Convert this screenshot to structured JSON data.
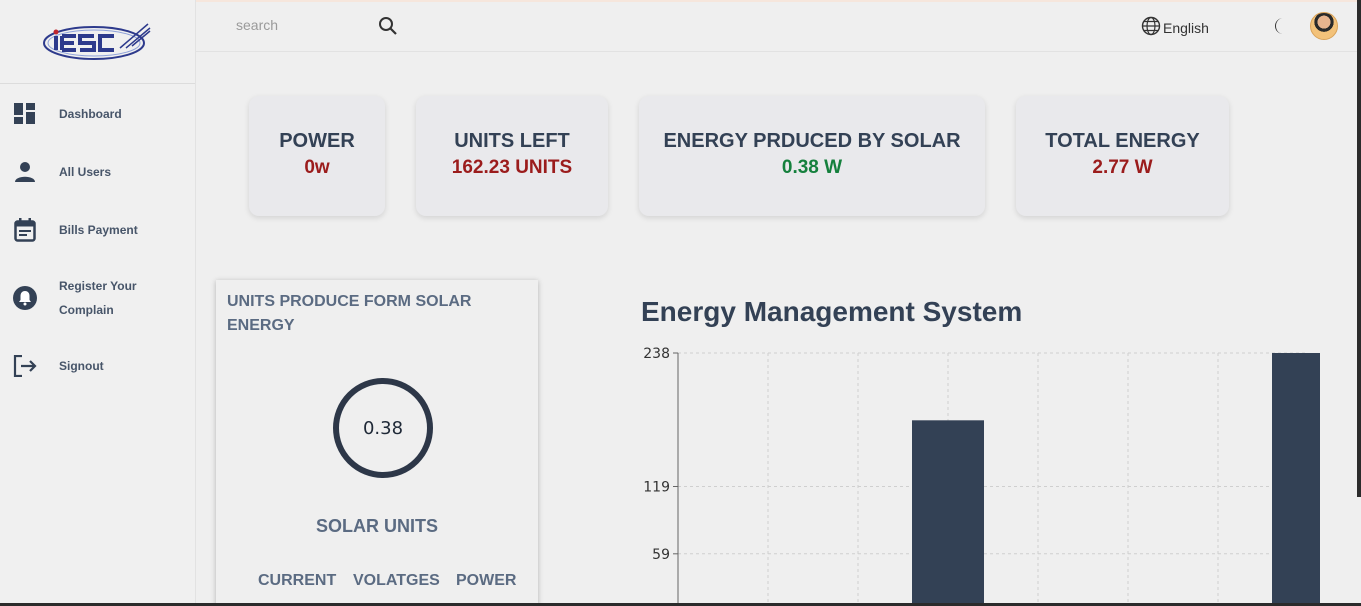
{
  "brand": {
    "logo_text": "IESC"
  },
  "sidebar": {
    "items": [
      {
        "label": "Dashboard",
        "icon": "dashboard-icon"
      },
      {
        "label": "All Users",
        "icon": "user-icon"
      },
      {
        "label": "Bills Payment",
        "icon": "calendar-icon"
      },
      {
        "label": "Register Your Complain",
        "icon": "bell-icon"
      },
      {
        "label": "Signout",
        "icon": "signout-icon"
      }
    ]
  },
  "topbar": {
    "search_placeholder": "search",
    "language": "English",
    "icons": {
      "search": "search-icon",
      "language": "globe-icon",
      "theme": "moon-icon"
    }
  },
  "stats": [
    {
      "title": "POWER",
      "value": "0w",
      "color": "#9b1c1c"
    },
    {
      "title": "UNITS LEFT",
      "value": "162.23 UNITS",
      "color": "#9b1c1c"
    },
    {
      "title": "ENERGY PRDUCED BY SOLAR",
      "value": "0.38 W",
      "color": "#15803d"
    },
    {
      "title": "TOTAL ENERGY",
      "value": "2.77 W",
      "color": "#9b1c1c"
    }
  ],
  "solar_panel": {
    "title": "UNITS PRODUCE FORM SOLAR ENERGY",
    "gauge_value": "0.38",
    "subtitle": "SOLAR UNITS",
    "columns": [
      "CURRENT",
      "VOLATGES",
      "POWER"
    ]
  },
  "colors": {
    "bar": "#334155",
    "accent_red": "#9b1c1c",
    "accent_green": "#15803d"
  },
  "chart_data": {
    "type": "bar",
    "title": "Energy Management System",
    "y_ticks": [
      "238",
      "119",
      "59"
    ],
    "ylim": [
      0,
      238
    ],
    "grid": true,
    "values": [
      0,
      178,
      0,
      238
    ]
  }
}
